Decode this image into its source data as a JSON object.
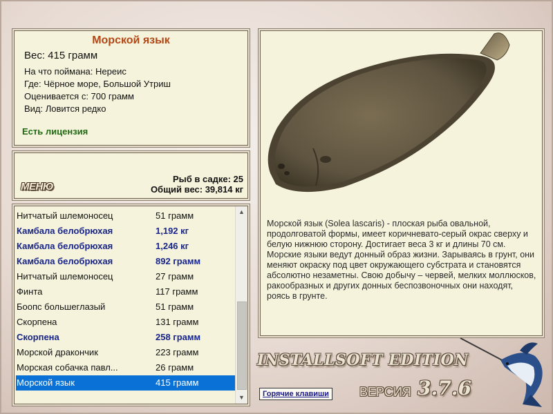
{
  "fish": {
    "name": "Морской язык",
    "weight": "Вес: 415 грамм",
    "bait": "На что поймана: Нереис",
    "location": "Где: Чёрное море, Большой Утриш",
    "value": "Оценивается с: 700 грамм",
    "rarity": "Вид: Ловится редко",
    "license": "Есть лицензия"
  },
  "summary": {
    "count": "Рыб в садке: 25",
    "total": "Общий вес: 39,814 кг",
    "menu_label": "МЕНЮ"
  },
  "catch": [
    {
      "name": "Нитчатый шлемоносец",
      "weight": "51 грамм",
      "style": ""
    },
    {
      "name": "Камбала белобрюхая",
      "weight": "1,192 кг",
      "style": "bold"
    },
    {
      "name": "Камбала белобрюхая",
      "weight": "1,246 кг",
      "style": "bold"
    },
    {
      "name": "Камбала белобрюхая",
      "weight": "892 грамм",
      "style": "bold"
    },
    {
      "name": "Нитчатый шлемоносец",
      "weight": "27 грамм",
      "style": ""
    },
    {
      "name": "Финта",
      "weight": "117 грамм",
      "style": ""
    },
    {
      "name": "Боопс большеглазый",
      "weight": "51 грамм",
      "style": ""
    },
    {
      "name": "Скорпена",
      "weight": "131 грамм",
      "style": ""
    },
    {
      "name": "Скорпена",
      "weight": "258 грамм",
      "style": "bold"
    },
    {
      "name": "Морской дракончик",
      "weight": "223 грамм",
      "style": ""
    },
    {
      "name": "Морская собачка павл...",
      "weight": "26 грамм",
      "style": ""
    },
    {
      "name": "Морской язык",
      "weight": "415 грамм",
      "style": "sel"
    }
  ],
  "description": "Морской язык (Solea lascaris) - плоская рыба овальной, продолговатой формы, имеет коричневато-серый окрас сверху и белую нижнюю сторону. Достигает веса 3 кг и длины 70 см. Морские языки ведут донный образ жизни. Зарываясь в грунт, они меняют окраску под цвет окружающего субстрата и становятся абсолютно незаметны. Свою добычу – червей, мелких моллюсков, ракообразных и других донных беспозвоночных они находят, роясь в грунте.",
  "hotkeys_label": "Горячие клавиши",
  "branding": {
    "edition": "INSTALLSOFT EDITION",
    "version_label": "ВЕРСИЯ",
    "version_number": "3.7.6"
  },
  "colors": {
    "title": "#b24614",
    "license": "#1f6a12",
    "bold_row": "#17248a",
    "selection": "#0a72d6"
  },
  "icons": [
    "scroll-up-icon",
    "scroll-down-icon",
    "marlin-logo"
  ]
}
